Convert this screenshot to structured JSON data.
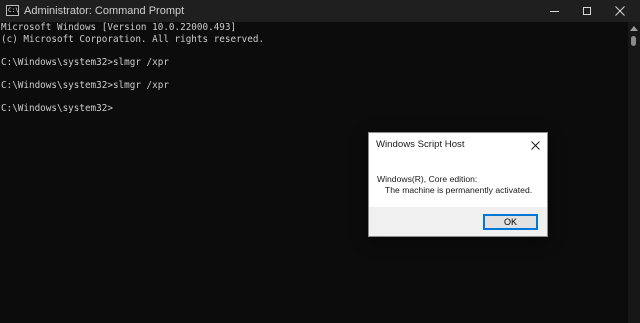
{
  "window": {
    "title": "Administrator: Command Prompt",
    "app_icon_text": "C:\\",
    "icons": {
      "app": "command-prompt-icon",
      "minimize": "minimize-icon",
      "maximize": "maximize-icon",
      "close": "close-icon"
    }
  },
  "console": {
    "lines": [
      "Microsoft Windows [Version 10.0.22000.493]",
      "(c) Microsoft Corporation. All rights reserved.",
      "",
      "C:\\Windows\\system32>slmgr /xpr",
      "",
      "C:\\Windows\\system32>slmgr /xpr",
      "",
      "C:\\Windows\\system32>"
    ]
  },
  "dialog": {
    "title": "Windows Script Host",
    "message_line1": "Windows(R), Core edition:",
    "message_line2": "The machine is permanently activated.",
    "ok_label": "OK",
    "close_icon": "close-icon"
  },
  "colors": {
    "console_bg": "#0c0c0c",
    "console_text": "#cccccc",
    "titlebar_bg": "#1f1f1f",
    "dialog_bg": "#f0f0f0",
    "accent": "#0078d7"
  }
}
